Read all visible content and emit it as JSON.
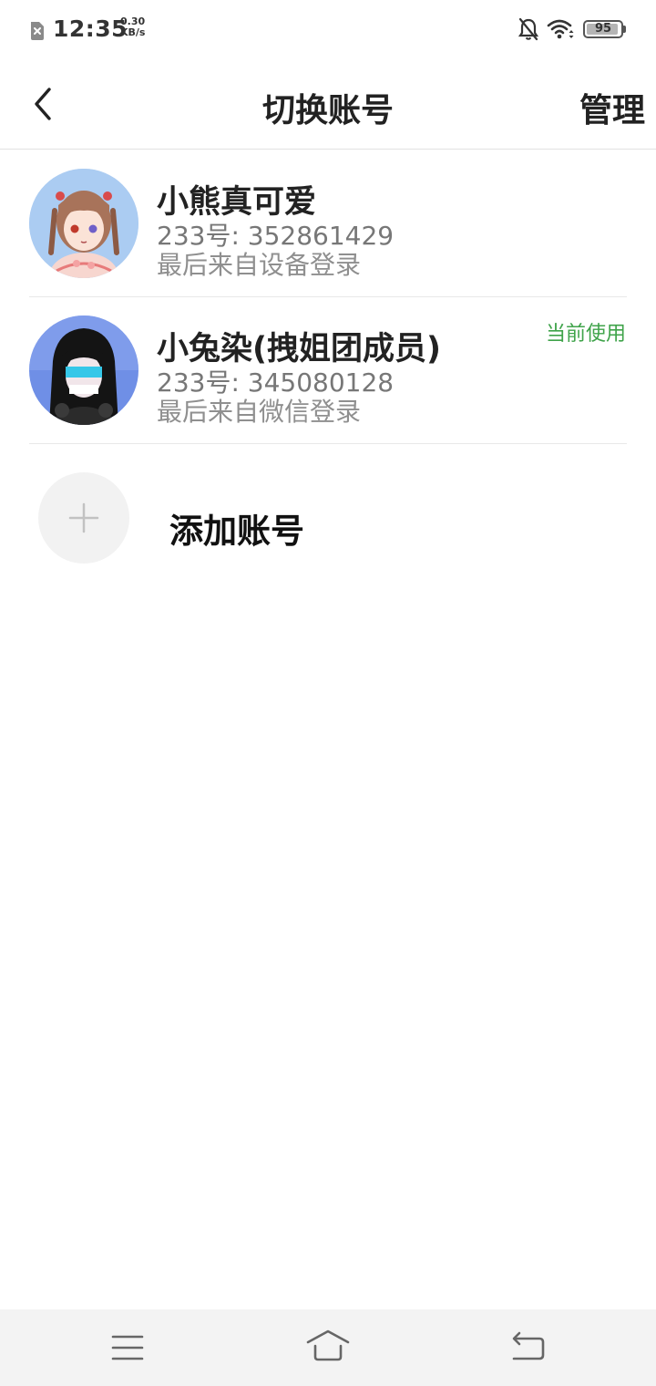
{
  "status_bar": {
    "time": "12:35",
    "net_speed_value": "0.30",
    "net_speed_unit": "KB/s",
    "battery_level": "95",
    "icons": [
      "sim-card-error-icon",
      "bell-off-icon",
      "wifi-icon",
      "battery-icon"
    ]
  },
  "header": {
    "back_icon": "back-arrow-icon",
    "title": "切换账号",
    "manage_label": "管理"
  },
  "accounts": [
    {
      "name": "小熊真可爱",
      "uid": "233号: 352861429",
      "login_source": "最后来自设备登录",
      "current_label": ""
    },
    {
      "name": "小兔染(拽姐团成员)",
      "uid": "233号: 345080128",
      "login_source": "最后来自微信登录",
      "current_label": "当前使用"
    }
  ],
  "add_account": {
    "label": "添加账号",
    "icon": "plus-icon"
  },
  "nav_bar": {
    "icons": [
      "menu-icon",
      "home-icon",
      "back-icon"
    ]
  },
  "colors": {
    "current_badge": "#3fa34a",
    "secondary_text": "#777777",
    "nav_background": "#f3f3f3"
  }
}
